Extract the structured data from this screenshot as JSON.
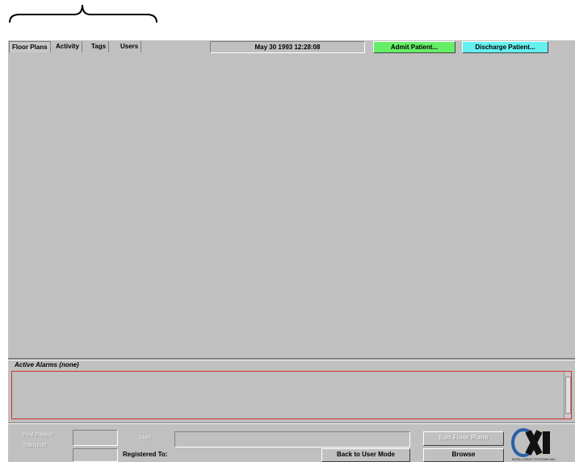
{
  "tabs": [
    {
      "label": "Floor Plans",
      "active": true
    },
    {
      "label": "Activity",
      "active": false
    },
    {
      "label": "Tags",
      "active": false
    },
    {
      "label": "Users",
      "active": false
    }
  ],
  "datetime": "May 30 1993  12:28:08",
  "admit_label": "Admit Patient...",
  "discharge_label": "Discharge Patient...",
  "alarms_label": "Active Alarms (none)",
  "footer": {
    "dim_label_1": "Find Patient",
    "dim_label_2": "Transport",
    "dim_label_3": "Alert",
    "registered_label": "Registered To:",
    "back_button": "Back to User Mode",
    "disabled_button": "Edit Floor Plans",
    "browse_button": "Browse"
  },
  "logo_subtext": "INTELLIGENT SYSTEMS INC",
  "colors": {
    "admit": "#66ee66",
    "discharge": "#66f0f0",
    "alarm_border": "#d03030"
  }
}
